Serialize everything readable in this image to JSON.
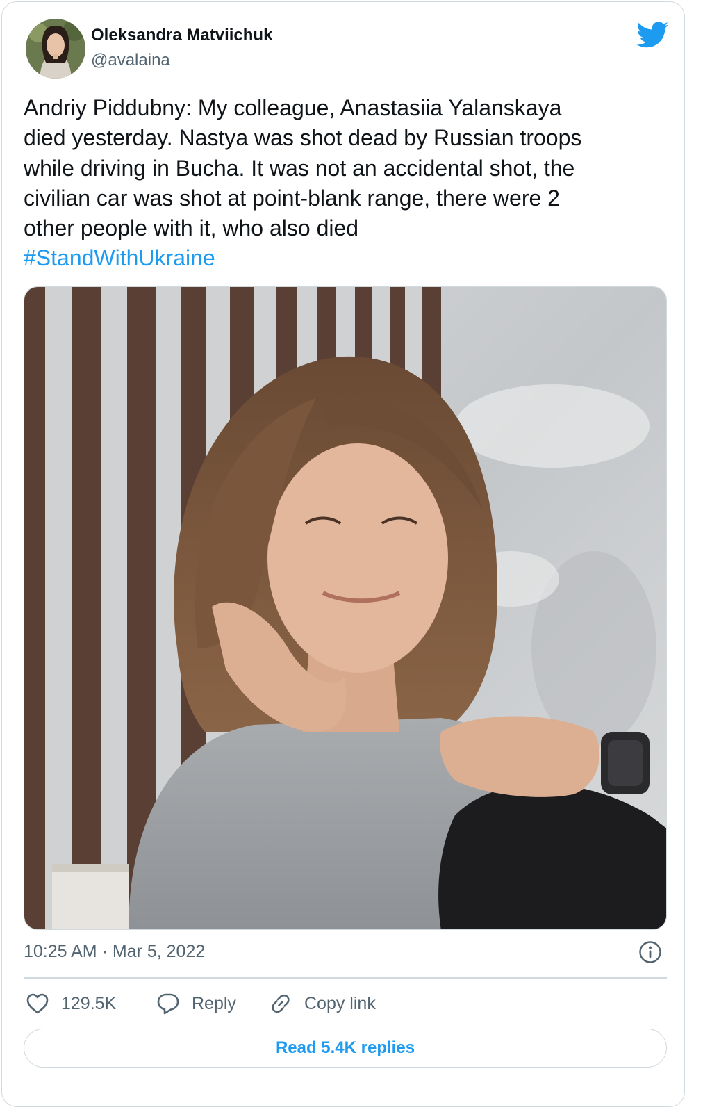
{
  "author": {
    "name": "Oleksandra Matviichuk",
    "handle": "@avalaina"
  },
  "tweet": {
    "text_lines": [
      "Andriy Piddubny: My colleague, Anastasiia Yalanskaya",
      "died yesterday. Nastya was shot dead by Russian troops",
      "while driving in Bucha. It was not an accidental shot, the",
      "civilian car was shot at point-blank range, there were 2",
      "other people with it, who also died"
    ],
    "hashtag": "#StandWithUkraine"
  },
  "meta": {
    "timestamp": "10:25 AM · Mar 5, 2022"
  },
  "actions": {
    "like_count": "129.5K",
    "reply_label": "Reply",
    "copy_link_label": "Copy link"
  },
  "footer": {
    "read_replies_label": "Read 5.4K replies"
  },
  "icons": {
    "brand": "twitter-bird-icon",
    "info": "info-icon",
    "like": "heart-icon",
    "reply": "speech-bubble-icon",
    "copy_link": "link-icon"
  },
  "colors": {
    "accent": "#1d9bf0",
    "text": "#0f1419",
    "secondary": "#536471",
    "border": "#cfd9de"
  }
}
